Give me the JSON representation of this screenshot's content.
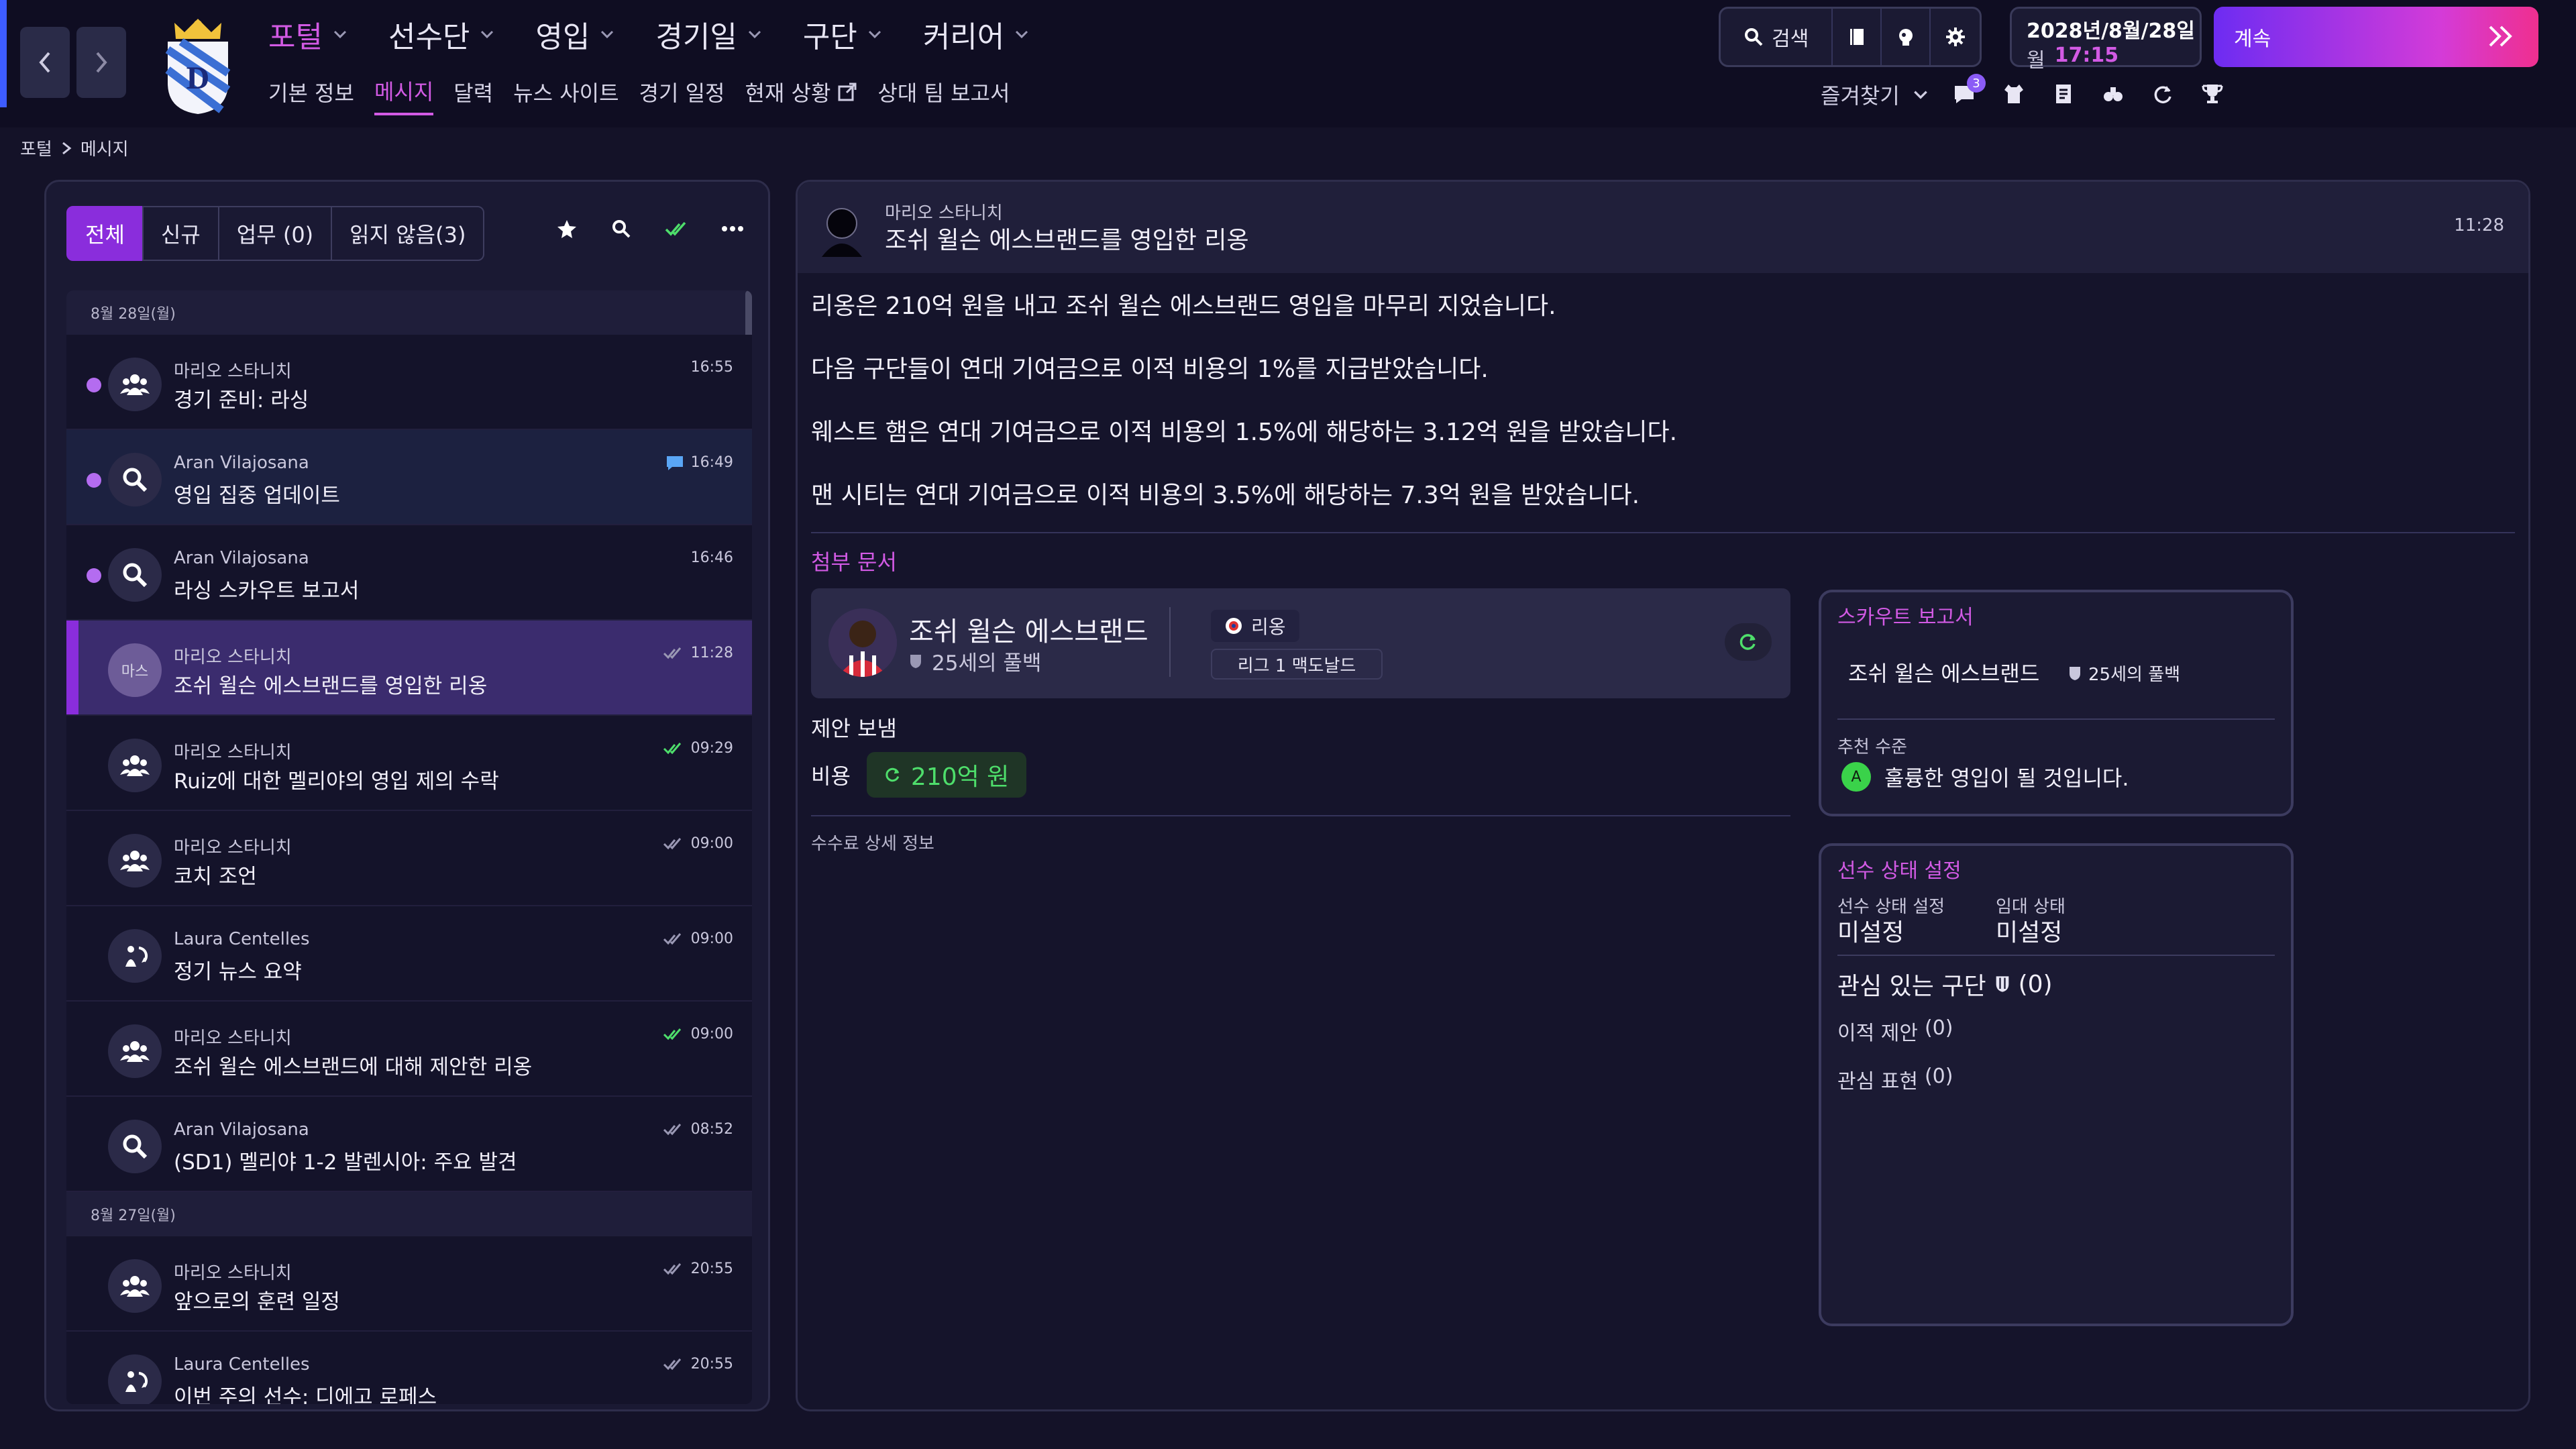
{
  "nav": {
    "items": [
      {
        "label": "포털",
        "active": true
      },
      {
        "label": "선수단",
        "active": false
      },
      {
        "label": "영입",
        "active": false
      },
      {
        "label": "경기일",
        "active": false
      },
      {
        "label": "구단",
        "active": false
      },
      {
        "label": "커리어",
        "active": false
      }
    ],
    "sub": [
      {
        "label": "기본 정보"
      },
      {
        "label": "메시지"
      },
      {
        "label": "달력"
      },
      {
        "label": "뉴스 사이트"
      },
      {
        "label": "경기 일정"
      },
      {
        "label": "현재 상황"
      },
      {
        "label": "상대 팀 보고서"
      }
    ]
  },
  "toolbar": {
    "search_label": "검색"
  },
  "date": {
    "line1": "2028년/8월/28일",
    "weekday": "월",
    "time": "17:15"
  },
  "continue_label": "계속",
  "favorites_label": "즐겨찾기",
  "notif_count": "3",
  "breadcrumb": {
    "root": "포털",
    "current": "메시지"
  },
  "filters": [
    "전체",
    "신규",
    "업무 (0)",
    "읽지 않음(3)"
  ],
  "inbox": {
    "day1": "8월 28일(월)",
    "day2": "8월 27일(월)",
    "messages": [
      {
        "from": "마리오 스타니치",
        "subject": "경기 준비: 라싱",
        "time": "16:55",
        "unread": true,
        "icon": "group-icon",
        "tick": "",
        "highlight": false
      },
      {
        "from": "Aran Vilajosana",
        "subject": "영입 집중 업데이트",
        "time": "16:49",
        "unread": true,
        "icon": "magnifier-icon",
        "tick": "comment",
        "highlight": true
      },
      {
        "from": "Aran Vilajosana",
        "subject": "라싱 스카우트 보고서",
        "time": "16:46",
        "unread": true,
        "icon": "magnifier-icon",
        "tick": "",
        "highlight": false
      },
      {
        "from": "마리오 스타니치",
        "subject": "조쉬 윌슨 에스브랜드를 영입한 리옹",
        "time": "11:28",
        "unread": false,
        "icon": "initials",
        "initials": "마스",
        "tick": "grey",
        "selected": true
      },
      {
        "from": "마리오 스타니치",
        "subject": "Ruiz에 대한 멜리야의 영입 제의 수락",
        "time": "09:29",
        "unread": false,
        "icon": "group-icon",
        "tick": "green"
      },
      {
        "from": "마리오 스타니치",
        "subject": "코치 조언",
        "time": "09:00",
        "unread": false,
        "icon": "group-icon",
        "tick": "grey"
      },
      {
        "from": "Laura Centelles",
        "subject": "정기 뉴스 요약",
        "time": "09:00",
        "unread": false,
        "icon": "news-icon",
        "tick": "grey"
      },
      {
        "from": "마리오 스타니치",
        "subject": "조쉬 윌슨 에스브랜드에 대해 제안한 리옹",
        "time": "09:00",
        "unread": false,
        "icon": "group-icon",
        "tick": "green"
      },
      {
        "from": "Aran Vilajosana",
        "subject": "(SD1) 멜리야 1-2 발렌시아: 주요 발견",
        "time": "08:52",
        "unread": false,
        "icon": "magnifier-icon",
        "tick": "grey"
      }
    ],
    "messages_prev": [
      {
        "from": "마리오 스타니치",
        "subject": "앞으로의 훈련 일정",
        "time": "20:55",
        "icon": "group-icon",
        "tick": "grey"
      },
      {
        "from": "Laura Centelles",
        "subject": "이번 주의 선수: 디에고 로페스",
        "time": "20:55",
        "icon": "news-icon",
        "tick": "grey"
      }
    ]
  },
  "reader": {
    "from": "마리오 스타니치",
    "subject": "조쉬 윌슨 에스브랜드를 영입한 리옹",
    "time": "11:28",
    "body": [
      "리옹은 210억 원을 내고 조쉬 윌슨 에스브랜드 영입을 마무리 지었습니다.",
      "다음 구단들이 연대 기여금으로 이적 비용의 1%를 지급받았습니다.",
      "웨스트 햄은 연대 기여금으로 이적 비용의 1.5%에 해당하는 3.12억 원을 받았습니다.",
      "맨 시티는 연대 기여금으로 이적 비용의 3.5%에 해당하는 7.3억 원을 받았습니다."
    ],
    "attachments_label": "첨부 문서",
    "player": {
      "name": "조쉬 윌슨 에스브랜드",
      "desc": "25세의 풀백",
      "club": "리옹",
      "league": "리그 1 맥도날드"
    },
    "offer_label": "제안 보냄",
    "cost_label": "비용",
    "cost_value": "210억 원",
    "fee_label": "수수료 상세 정보"
  },
  "scout": {
    "title": "스카우트 보고서",
    "player": "조쉬 윌슨 에스브랜드",
    "desc": "25세의 풀백",
    "rec_label": "추천 수준",
    "grade": "A",
    "rec_text": "훌륭한 영입이 될 것입니다."
  },
  "status": {
    "title": "선수 상태 설정",
    "set_label": "선수 상태 설정",
    "set_value": "미설정",
    "loan_label": "임대 상태",
    "loan_value": "미설정",
    "interest_title": "관심 있는 구단",
    "interest_count": "(0)",
    "offers_label": "이적 제안",
    "offers_count": "(0)",
    "expr_label": "관심 표현",
    "expr_count": "(0)"
  },
  "colors": {
    "accent": "#d25ae4",
    "selected": "#8a2ddc",
    "green": "#4ede6b"
  }
}
